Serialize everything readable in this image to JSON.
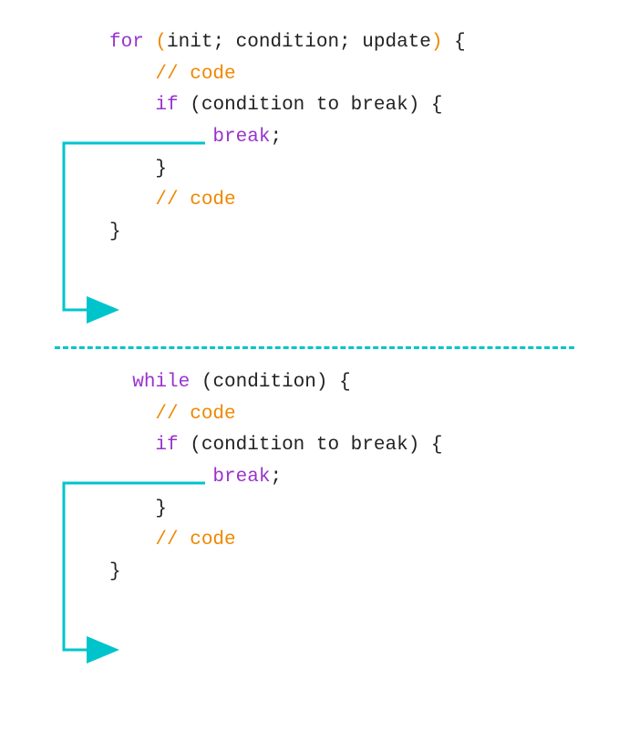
{
  "colors": {
    "keyword": "#9933cc",
    "accent_orange": "#ee8800",
    "plain": "#222222",
    "arrow": "#00c4cc"
  },
  "for_block": {
    "keyword_for": "for",
    "paren_open": "(",
    "init_cond_update": "init; condition; update",
    "paren_close": ")",
    "brace_open": " {",
    "comment1": "// code",
    "keyword_if": "if",
    "if_cond_open": " (",
    "if_cond_text": "condition to break",
    "if_cond_close": ") {",
    "keyword_break": "break",
    "semicolon": ";",
    "if_brace_close": "}",
    "comment2": "// code",
    "for_brace_close": "}"
  },
  "while_block": {
    "keyword_while": "while",
    "paren_open": " (",
    "cond_text": "condition",
    "paren_close": ") {",
    "comment1": "// code",
    "keyword_if": "if",
    "if_cond_open": " (",
    "if_cond_text": "condition to break",
    "if_cond_close": ") {",
    "keyword_break": "break",
    "semicolon": ";",
    "if_brace_close": "}",
    "comment2": "// code",
    "while_brace_close": "}"
  }
}
